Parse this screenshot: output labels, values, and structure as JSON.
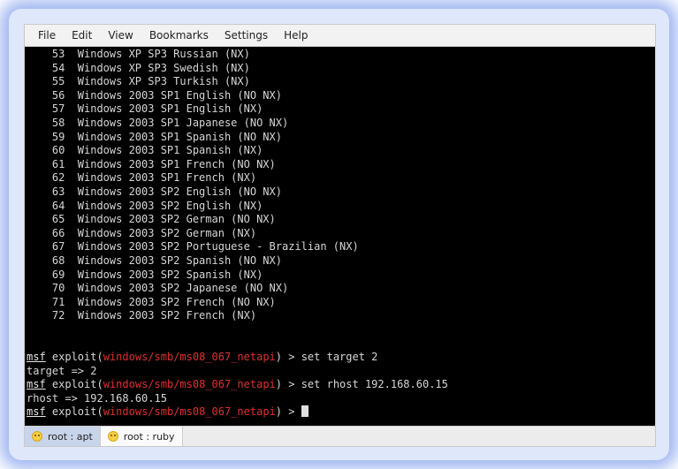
{
  "menu": [
    "File",
    "Edit",
    "View",
    "Bookmarks",
    "Settings",
    "Help"
  ],
  "targets": [
    {
      "num": "53",
      "name": "Windows XP SP3 Russian (NX)"
    },
    {
      "num": "54",
      "name": "Windows XP SP3 Swedish (NX)"
    },
    {
      "num": "55",
      "name": "Windows XP SP3 Turkish (NX)"
    },
    {
      "num": "56",
      "name": "Windows 2003 SP1 English (NO NX)"
    },
    {
      "num": "57",
      "name": "Windows 2003 SP1 English (NX)"
    },
    {
      "num": "58",
      "name": "Windows 2003 SP1 Japanese (NO NX)"
    },
    {
      "num": "59",
      "name": "Windows 2003 SP1 Spanish (NO NX)"
    },
    {
      "num": "60",
      "name": "Windows 2003 SP1 Spanish (NX)"
    },
    {
      "num": "61",
      "name": "Windows 2003 SP1 French (NO NX)"
    },
    {
      "num": "62",
      "name": "Windows 2003 SP1 French (NX)"
    },
    {
      "num": "63",
      "name": "Windows 2003 SP2 English (NO NX)"
    },
    {
      "num": "64",
      "name": "Windows 2003 SP2 English (NX)"
    },
    {
      "num": "65",
      "name": "Windows 2003 SP2 German (NO NX)"
    },
    {
      "num": "66",
      "name": "Windows 2003 SP2 German (NX)"
    },
    {
      "num": "67",
      "name": "Windows 2003 SP2 Portuguese - Brazilian (NX)"
    },
    {
      "num": "68",
      "name": "Windows 2003 SP2 Spanish (NO NX)"
    },
    {
      "num": "69",
      "name": "Windows 2003 SP2 Spanish (NX)"
    },
    {
      "num": "70",
      "name": "Windows 2003 SP2 Japanese (NO NX)"
    },
    {
      "num": "71",
      "name": "Windows 2003 SP2 French (NO NX)"
    },
    {
      "num": "72",
      "name": "Windows 2003 SP2 French (NX)"
    }
  ],
  "prompt": {
    "msf": "msf",
    "exploit_open": " exploit(",
    "module": "windows/smb/ms08_067_netapi",
    "close": ") > "
  },
  "session": {
    "cmd1": "set target 2",
    "out1": "target => 2",
    "cmd2": "set rhost 192.168.60.15",
    "out2": "rhost => 192.168.60.15"
  },
  "tabs": [
    {
      "label": "root : apt",
      "icon": "smiley-icon"
    },
    {
      "label": "root : ruby",
      "icon": "smiley-icon"
    }
  ],
  "colors": {
    "terminal_bg": "#000000",
    "terminal_fg": "#d6d6d6",
    "module_red": "#e03030",
    "glow_blue": "#5078e6",
    "active_tab": "#c8d4ea"
  }
}
